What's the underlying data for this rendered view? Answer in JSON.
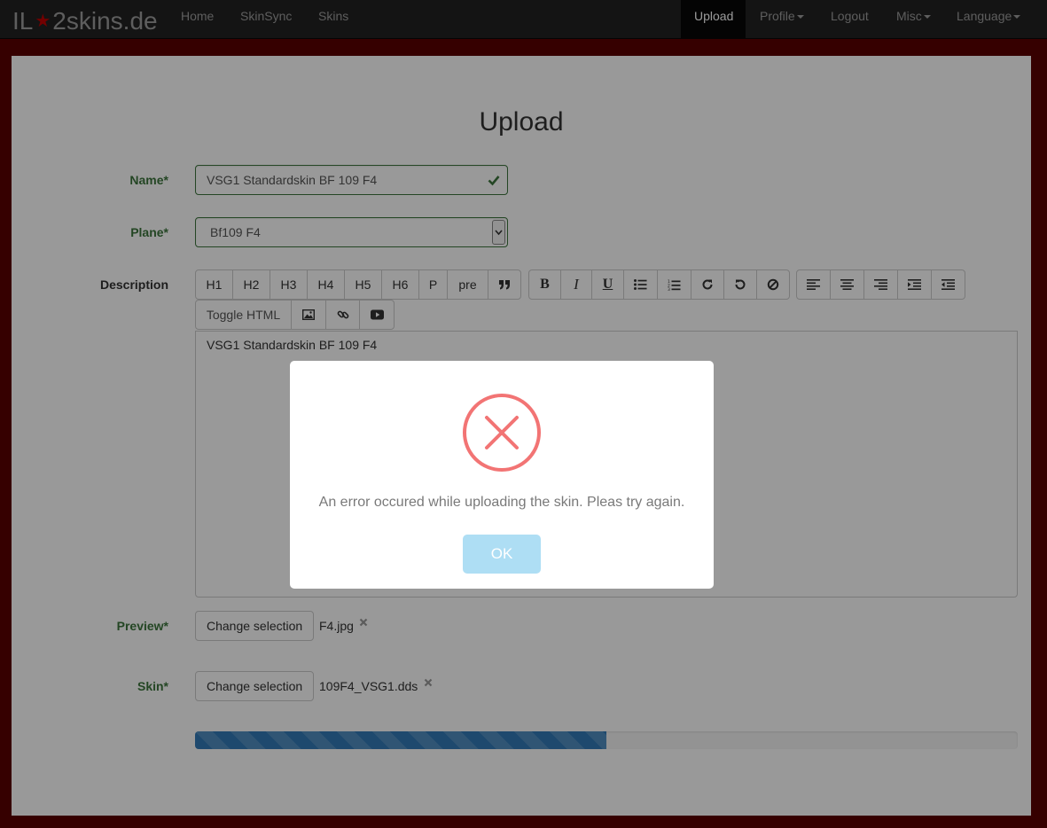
{
  "nav": {
    "brand_left": "IL",
    "brand_right": "2skins.de",
    "links": [
      "Home",
      "SkinSync",
      "Skins"
    ],
    "upload": "Upload",
    "profile": "Profile",
    "logout": "Logout",
    "misc": "Misc",
    "language": "Language"
  },
  "page": {
    "title": "Upload"
  },
  "form": {
    "name_label": "Name*",
    "name_value": "VSG1 Standardskin BF 109 F4",
    "plane_label": "Plane*",
    "plane_value": "Bf109 F4",
    "description_label": "Description",
    "description_text": "VSG1 Standardskin BF 109 F4",
    "preview_label": "Preview*",
    "preview_button": "Change selection",
    "preview_file": "F4.jpg",
    "skin_label": "Skin*",
    "skin_button": "Change selection",
    "skin_file": "109F4_VSG1.dds",
    "progress_percent": 50
  },
  "toolbar": {
    "headings": [
      "H1",
      "H2",
      "H3",
      "H4",
      "H5",
      "H6",
      "P",
      "pre"
    ],
    "quote_icon": "quote-icon",
    "format_icons": [
      "bold-icon",
      "italic-icon",
      "underline-icon",
      "unordered-list-icon",
      "ordered-list-icon",
      "redo-icon",
      "undo-icon",
      "clear-format-icon"
    ],
    "align_icons": [
      "align-left-icon",
      "align-center-icon",
      "align-right-icon",
      "indent-icon",
      "outdent-icon"
    ],
    "toggle_html": "Toggle HTML",
    "insert_icons": [
      "image-icon",
      "link-icon",
      "video-icon"
    ]
  },
  "modal": {
    "message": "An error occured while uploading the skin. Pleas try again.",
    "ok": "OK"
  },
  "colors": {
    "page_border": "#5a0000",
    "success": "#3c763d",
    "error": "#f27474",
    "progress": "#337ab7",
    "ok_button": "#aedef4"
  }
}
